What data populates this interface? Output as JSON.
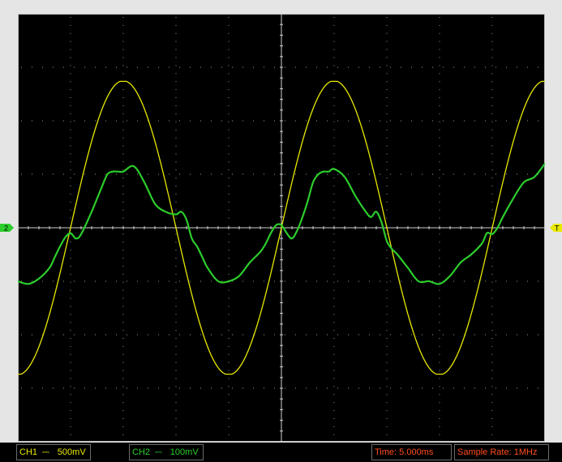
{
  "chart_data": {
    "type": "line",
    "title": "",
    "xlabel": "",
    "ylabel": "",
    "grid": true,
    "divisions": {
      "horizontal": 10,
      "vertical": 8
    },
    "time_per_div_ms": 5,
    "x_unit": "ms",
    "xlim": [
      -25,
      25
    ],
    "ylim_div": [
      -4,
      4
    ],
    "series": [
      {
        "channel": "CH1",
        "color": "#e8e800",
        "volts_per_div_mV": 500,
        "type": "sine",
        "amplitude_div": 2.75,
        "period_ms": 20,
        "zero_crossing_ms": 0,
        "offset_div": 0
      },
      {
        "channel": "CH2",
        "color": "#2ccd2c",
        "volts_per_div_mV": 100,
        "x": [
          -25,
          -24,
          -23,
          -22,
          -21.5,
          -21,
          -20.5,
          -20,
          -19.5,
          -19,
          -18,
          -17,
          -16.5,
          -16,
          -15.5,
          -15,
          -14,
          -13,
          -12,
          -11,
          -10,
          -9.5,
          -9,
          -8.5,
          -8,
          -7.5,
          -7,
          -6,
          -5,
          -4,
          -3,
          -2,
          -1.5,
          -1,
          -0.5,
          0,
          0.5,
          1,
          1.5,
          2,
          2.5,
          3,
          3.5,
          4,
          4.5,
          5,
          6,
          7,
          8,
          8.5,
          9,
          9.5,
          10,
          10.5,
          11,
          12,
          13,
          14,
          15,
          16,
          17,
          18,
          19,
          19.5,
          20,
          20.5,
          21,
          22,
          23,
          24,
          25
        ],
        "y_div": [
          -1.0,
          -1.05,
          -0.95,
          -0.75,
          -0.55,
          -0.35,
          -0.18,
          -0.1,
          -0.2,
          -0.12,
          0.3,
          0.78,
          1.0,
          1.05,
          1.05,
          1.05,
          1.15,
          0.85,
          0.45,
          0.3,
          0.25,
          0.3,
          0.15,
          -0.2,
          -0.35,
          -0.55,
          -0.75,
          -1.0,
          -1.0,
          -0.9,
          -0.65,
          -0.45,
          -0.3,
          -0.1,
          0.05,
          0.05,
          -0.1,
          -0.2,
          -0.05,
          0.2,
          0.5,
          0.85,
          1.0,
          1.05,
          1.05,
          1.1,
          0.95,
          0.6,
          0.3,
          0.2,
          0.3,
          0.1,
          -0.25,
          -0.4,
          -0.5,
          -0.75,
          -1.0,
          -1.0,
          -1.05,
          -0.9,
          -0.65,
          -0.5,
          -0.3,
          -0.1,
          -0.12,
          0.0,
          0.2,
          0.55,
          0.85,
          0.95,
          1.2
        ]
      }
    ],
    "markers": {
      "ch2_ground": "2",
      "trigger": "T"
    },
    "readouts": {
      "ch1_label": "CH1",
      "ch1_coupling": "⎓",
      "ch1_scale": "500mV",
      "ch2_label": "CH2",
      "ch2_coupling": "⎓",
      "ch2_scale": "100mV",
      "time_label": "Time:",
      "time_value": "5.000ms",
      "rate_label": "Sample Rate:",
      "rate_value": "1MHz"
    }
  }
}
